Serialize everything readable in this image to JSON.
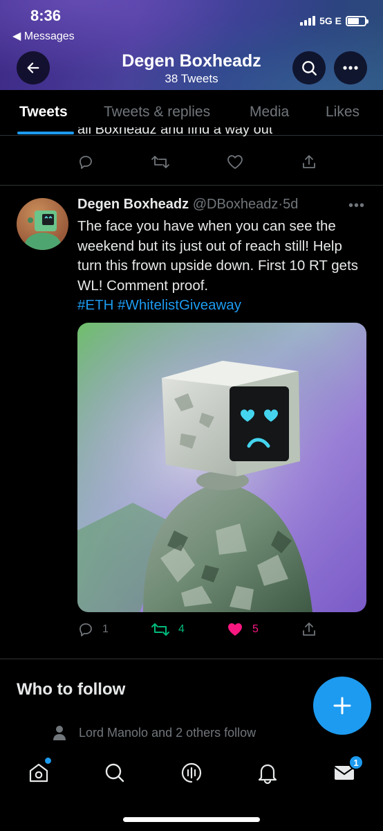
{
  "status_bar": {
    "time": "8:36",
    "back_app": "Messages",
    "network": "5G E"
  },
  "profile_header": {
    "title": "Degen Boxheadz",
    "subtitle": "38 Tweets"
  },
  "tabs": [
    {
      "label": "Tweets",
      "active": true
    },
    {
      "label": "Tweets & replies",
      "active": false
    },
    {
      "label": "Media",
      "active": false
    },
    {
      "label": "Likes",
      "active": false
    }
  ],
  "prev_tweet": {
    "partial_text": "all Boxheadz and find a way out"
  },
  "tweet": {
    "name": "Degen Boxheadz",
    "handle": "@DBoxheadz",
    "separator": "·",
    "age": "5d",
    "text": "The face you have when you can see the weekend but its just out of reach still! Help turn this frown upside down. First 10 RT gets WL! Comment proof.",
    "hashtags": "#ETH #WhitelistGiveaway",
    "replies": "1",
    "retweets": "4",
    "likes": "5",
    "retweeted": true,
    "liked": true
  },
  "who_to_follow": {
    "heading": "Who to follow",
    "social_context": "Lord Manolo and 2 others follow"
  },
  "bottom_nav": {
    "messages_badge": "1"
  },
  "colors": {
    "accent": "#1d9bf0",
    "retweet": "#00ba7c",
    "like": "#f91880",
    "muted": "#71767b"
  },
  "icons": [
    "back-arrow-icon",
    "search-icon",
    "more-icon",
    "reply-icon",
    "retweet-icon",
    "heart-icon",
    "share-icon",
    "person-icon",
    "compose-plus-icon",
    "home-icon",
    "explore-icon",
    "spaces-icon",
    "bell-icon",
    "mail-icon"
  ]
}
